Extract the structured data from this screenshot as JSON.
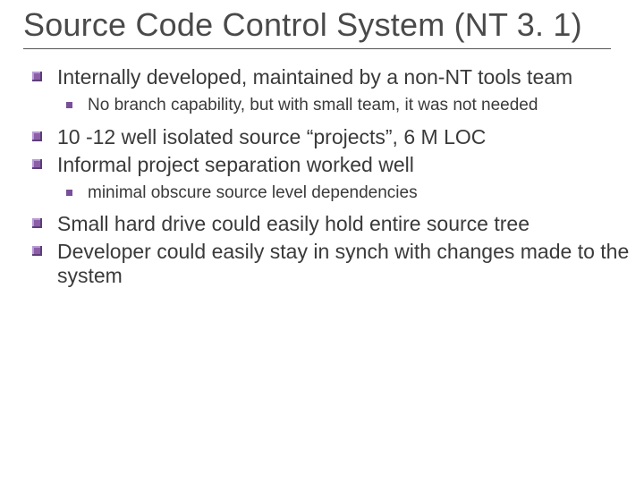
{
  "title": "Source Code Control System (NT 3. 1)",
  "items": [
    {
      "text": "Internally developed, maintained by a non-NT tools team",
      "sub": [
        "No branch capability, but with small team, it was not needed"
      ]
    },
    {
      "text": "10 -12 well isolated source “projects”, 6 M LOC",
      "sub": []
    },
    {
      "text": "Informal project separation worked well",
      "sub": [
        "minimal obscure source level dependencies"
      ]
    },
    {
      "text": "Small hard drive could easily hold entire source tree",
      "sub": []
    },
    {
      "text": "Developer could easily stay in synch with changes made to the system",
      "sub": []
    }
  ]
}
